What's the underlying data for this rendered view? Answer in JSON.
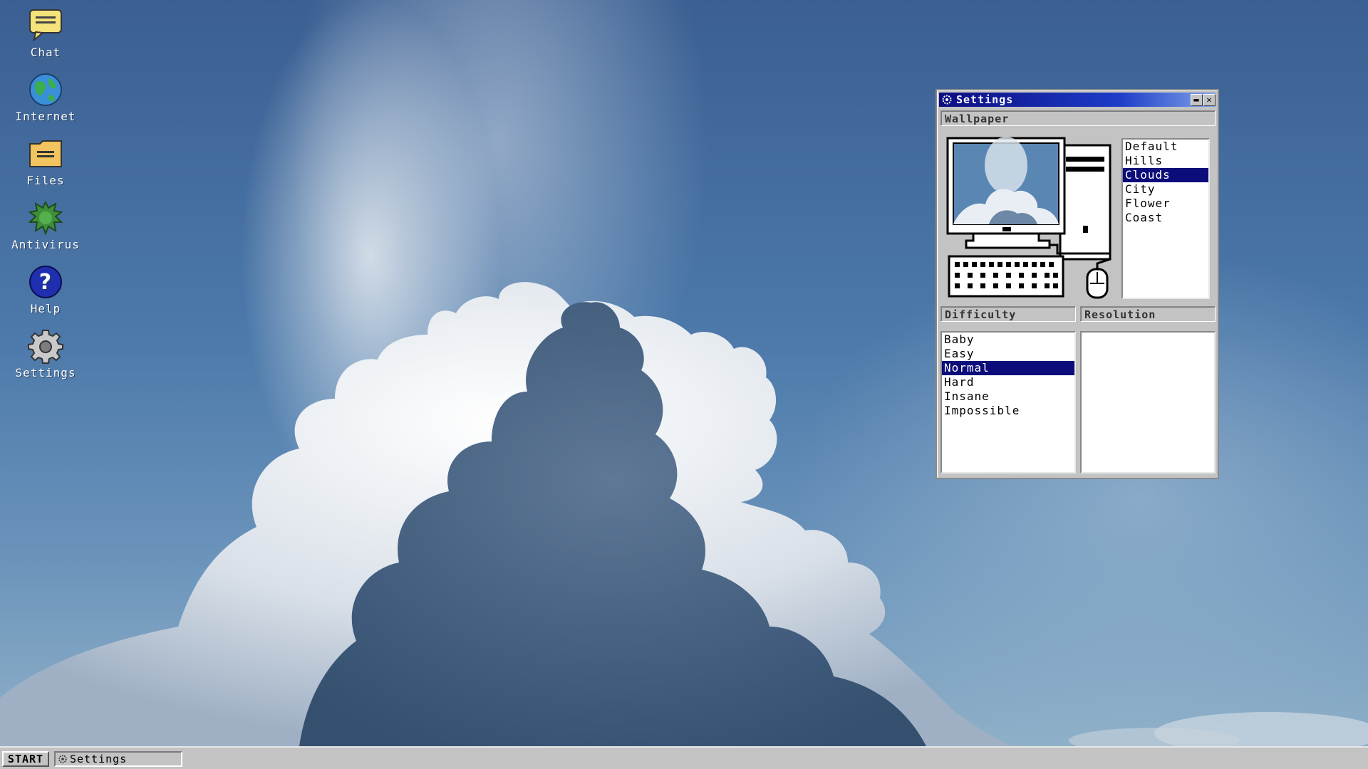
{
  "desktop": {
    "icons": [
      {
        "label": "Chat",
        "icon": "chat-bubble-icon"
      },
      {
        "label": "Internet",
        "icon": "globe-icon"
      },
      {
        "label": "Files",
        "icon": "folder-icon"
      },
      {
        "label": "Antivirus",
        "icon": "antivirus-bug-icon"
      },
      {
        "label": "Help",
        "icon": "help-question-icon"
      },
      {
        "label": "Settings",
        "icon": "gear-icon"
      }
    ]
  },
  "settings_window": {
    "title": "Settings",
    "title_icon": "gear-icon",
    "minimize_glyph": "▬",
    "close_glyph": "✕",
    "wallpaper_section": {
      "label": "Wallpaper",
      "options": [
        "Default",
        "Hills",
        "Clouds",
        "City",
        "Flower",
        "Coast"
      ],
      "selected": "Clouds"
    },
    "difficulty_section": {
      "label": "Difficulty",
      "options": [
        "Baby",
        "Easy",
        "Normal",
        "Hard",
        "Insane",
        "Impossible"
      ],
      "selected": "Normal"
    },
    "resolution_section": {
      "label": "Resolution",
      "options": []
    }
  },
  "taskbar": {
    "start_label": "START",
    "tasks": [
      {
        "label": "Settings",
        "icon": "gear-icon"
      }
    ]
  },
  "colors": {
    "title_bar_start": "#0d0d80",
    "title_bar_end": "#7fa3e8",
    "selection": "#0c0c7a",
    "chrome_gray": "#c3c3c3"
  }
}
